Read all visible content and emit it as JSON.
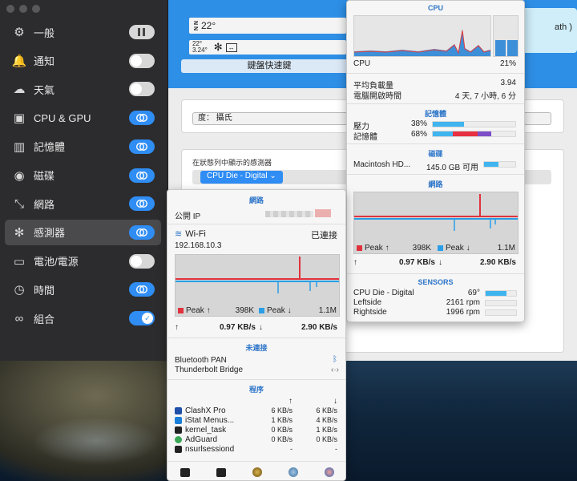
{
  "colors": {
    "accent": "#2f8df4",
    "peak_red": "#e0323c",
    "peak_blue": "#2a9ee6",
    "section_blue": "#2c74c8"
  },
  "sidebar": {
    "items": [
      {
        "label": "一般",
        "icon": "gear-icon",
        "toggle": "gray"
      },
      {
        "label": "通知",
        "icon": "bell-icon",
        "toggle": "off"
      },
      {
        "label": "天氣",
        "icon": "cloud-sun-icon",
        "toggle": "off"
      },
      {
        "label": "CPU & GPU",
        "icon": "chip-icon",
        "toggle": "on"
      },
      {
        "label": "記憶體",
        "icon": "memory-icon",
        "toggle": "on"
      },
      {
        "label": "磁碟",
        "icon": "disk-icon",
        "toggle": "on"
      },
      {
        "label": "網路",
        "icon": "network-arrows-icon",
        "toggle": "on"
      },
      {
        "label": "感測器",
        "icon": "fan-icon",
        "toggle": "on"
      },
      {
        "label": "電池/電源",
        "icon": "battery-icon",
        "toggle": "off"
      },
      {
        "label": "時間",
        "icon": "clock-icon",
        "toggle": "on"
      },
      {
        "label": "組合",
        "icon": "combine-icon",
        "toggle": "check"
      }
    ]
  },
  "main": {
    "menubar_temp": "22°",
    "menubar_small_top": "22°",
    "menubar_small_bottom": "3.24°",
    "shortcut_button": "鍵盤快速鍵",
    "right_preview_text": "ath )",
    "unit_field": "度： 攝氏",
    "sensor_list_title": "在狀態列中顯示的感測器",
    "sensor_select": "CPU Die - Digital"
  },
  "cpu_popover": {
    "title": "CPU",
    "cpu_label": "CPU",
    "cpu_value": "21%",
    "load_label": "平均負載量",
    "load_value": "3.94",
    "uptime_label": "電腦開啟時間",
    "uptime_value": "4 天, 7 小時, 6 分",
    "memory_title": "記憶體",
    "pressure_label": "壓力",
    "pressure_value": "38%",
    "pressure_fraction": 0.38,
    "mem_label": "記憶體",
    "mem_value": "68%",
    "disk_title": "磁碟",
    "disk_name": "Macintosh HD...",
    "disk_value": "145.0 GB 可用",
    "disk_fraction": 0.45,
    "network_title": "網路",
    "peak_up_label": "Peak ↑",
    "peak_up_value": "398K",
    "peak_down_label": "Peak ↓",
    "peak_down_value": "1.1M",
    "rate_up_arrow": "↑",
    "rate_up": "0.97 KB/s",
    "rate_down_arrow": "↓",
    "rate_down": "2.90 KB/s",
    "sensors_title": "SENSORS",
    "sensors": [
      {
        "name": "CPU Die - Digital",
        "value": "69°",
        "fraction": 0.69
      },
      {
        "name": "Leftside",
        "value": "2161 rpm",
        "fraction": 0.0
      },
      {
        "name": "Rightside",
        "value": "1996 rpm",
        "fraction": 0.0
      }
    ]
  },
  "net_popover": {
    "title": "網路",
    "public_ip_label": "公開 IP",
    "wifi_label": "Wi-Fi",
    "wifi_status": "已連接",
    "local_ip": "192.168.10.3",
    "peak_up_label": "Peak ↑",
    "peak_up_value": "398K",
    "peak_down_label": "Peak ↓",
    "peak_down_value": "1.1M",
    "rate_up_arrow": "↑",
    "rate_up": "0.97 KB/s",
    "rate_down_arrow": "↓",
    "rate_down": "2.90 KB/s",
    "disconnected_title": "未連接",
    "bluetooth_pan": "Bluetooth PAN",
    "thunderbolt_bridge": "Thunderbolt Bridge",
    "apps_title": "程序",
    "col_up": "↑",
    "col_down": "↓",
    "apps": [
      {
        "name": "ClashX Pro",
        "up": "6 KB/s",
        "down": "6 KB/s",
        "icon": "clashx-icon"
      },
      {
        "name": "iStat Menus...",
        "up": "1 KB/s",
        "down": "4 KB/s",
        "icon": "istat-icon"
      },
      {
        "name": "kernel_task",
        "up": "0 KB/s",
        "down": "1 KB/s",
        "icon": "terminal-icon"
      },
      {
        "name": "AdGuard",
        "up": "0 KB/s",
        "down": "0 KB/s",
        "icon": "adguard-icon"
      },
      {
        "name": "nsurlsessiond",
        "up": "-",
        "down": "-",
        "icon": "terminal-icon"
      }
    ]
  }
}
